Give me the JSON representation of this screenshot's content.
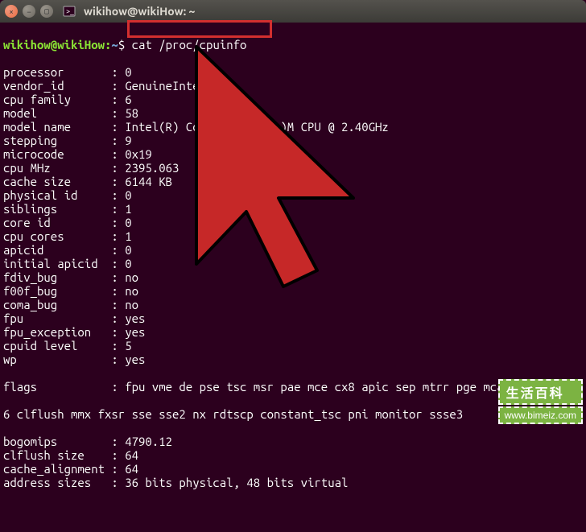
{
  "window": {
    "title": "wikihow@wikiHow: ~"
  },
  "prompt": {
    "userhost": "wikihow@wikiHow",
    "path": "~",
    "command": "cat /proc/cpuinfo"
  },
  "cpuinfo": [
    {
      "k": "processor",
      "v": "0"
    },
    {
      "k": "vendor_id",
      "v": "GenuineIntel"
    },
    {
      "k": "cpu family",
      "v": "6"
    },
    {
      "k": "model",
      "v": "58"
    },
    {
      "k": "model name",
      "v": "Intel(R) Core(         )M CPU @ 2.40GHz"
    },
    {
      "k": "stepping",
      "v": "9"
    },
    {
      "k": "microcode",
      "v": "0x19"
    },
    {
      "k": "cpu MHz",
      "v": "2395.063"
    },
    {
      "k": "cache size",
      "v": "6144 KB"
    },
    {
      "k": "physical id",
      "v": "0"
    },
    {
      "k": "siblings",
      "v": "1"
    },
    {
      "k": "core id",
      "v": "0"
    },
    {
      "k": "cpu cores",
      "v": "1"
    },
    {
      "k": "apicid",
      "v": "0"
    },
    {
      "k": "initial apicid",
      "v": "0"
    },
    {
      "k": "fdiv_bug",
      "v": "no"
    },
    {
      "k": "f00f_bug",
      "v": "no"
    },
    {
      "k": "coma_bug",
      "v": "no"
    },
    {
      "k": "fpu",
      "v": "yes"
    },
    {
      "k": "fpu_exception",
      "v": "yes"
    },
    {
      "k": "cpuid level",
      "v": "5"
    },
    {
      "k": "wp",
      "v": "yes"
    }
  ],
  "flags_line1": "flags           : fpu vme de pse tsc msr pae mce cx8 apic sep mtrr pge mca cmov pa",
  "flags_line2": "6 clflush mmx fxsr sse sse2 nx rdtscp constant_tsc pni monitor ssse3",
  "tail": [
    {
      "k": "bogomips",
      "v": "4790.12"
    },
    {
      "k": "clflush size",
      "v": "64"
    },
    {
      "k": "cache_alignment",
      "v": "64"
    },
    {
      "k": "address sizes",
      "v": "36 bits physical, 48 bits virtual"
    }
  ],
  "watermark": {
    "top": "生活百科",
    "bottom": "www.bimeiz.com"
  }
}
